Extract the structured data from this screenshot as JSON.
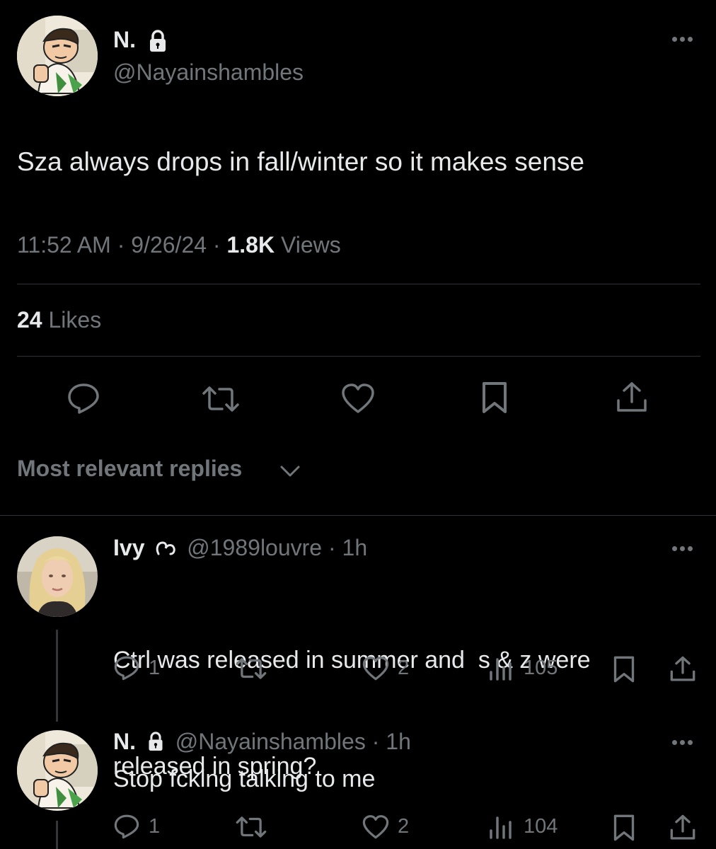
{
  "main_tweet": {
    "display_name": "N.",
    "handle": "@Nayainshambles",
    "text": "Sza always drops in fall/winter so it makes sense",
    "time": "11:52 AM",
    "date": "9/26/24",
    "views_count": "1.8K",
    "views_label": "Views",
    "likes_count": "24",
    "likes_label": "Likes"
  },
  "replies_filter": {
    "label": "Most relevant replies"
  },
  "replies": [
    {
      "display_name": "Ivy",
      "handle": "@1989louvre",
      "age": "1h",
      "text_line1": "Ctrl was released in summer and  s & z were",
      "text_line2": "released in spring?",
      "reply_count": "1",
      "like_count": "2",
      "view_count": "105"
    },
    {
      "display_name": "N.",
      "handle": "@Nayainshambles",
      "age": "1h",
      "text_line1": "Stop fcking talking to me",
      "reply_count": "1",
      "like_count": "2",
      "view_count": "104"
    }
  ],
  "colors": {
    "background": "#000000",
    "text": "#e7e9ea",
    "muted": "#71767b",
    "divider": "#2f3336"
  },
  "icons": [
    "more-icon",
    "lock-icon",
    "reply-icon",
    "retweet-icon",
    "like-icon",
    "bookmark-icon",
    "share-icon",
    "views-icon",
    "chevron-down-icon",
    "subscribed-badge-icon"
  ]
}
